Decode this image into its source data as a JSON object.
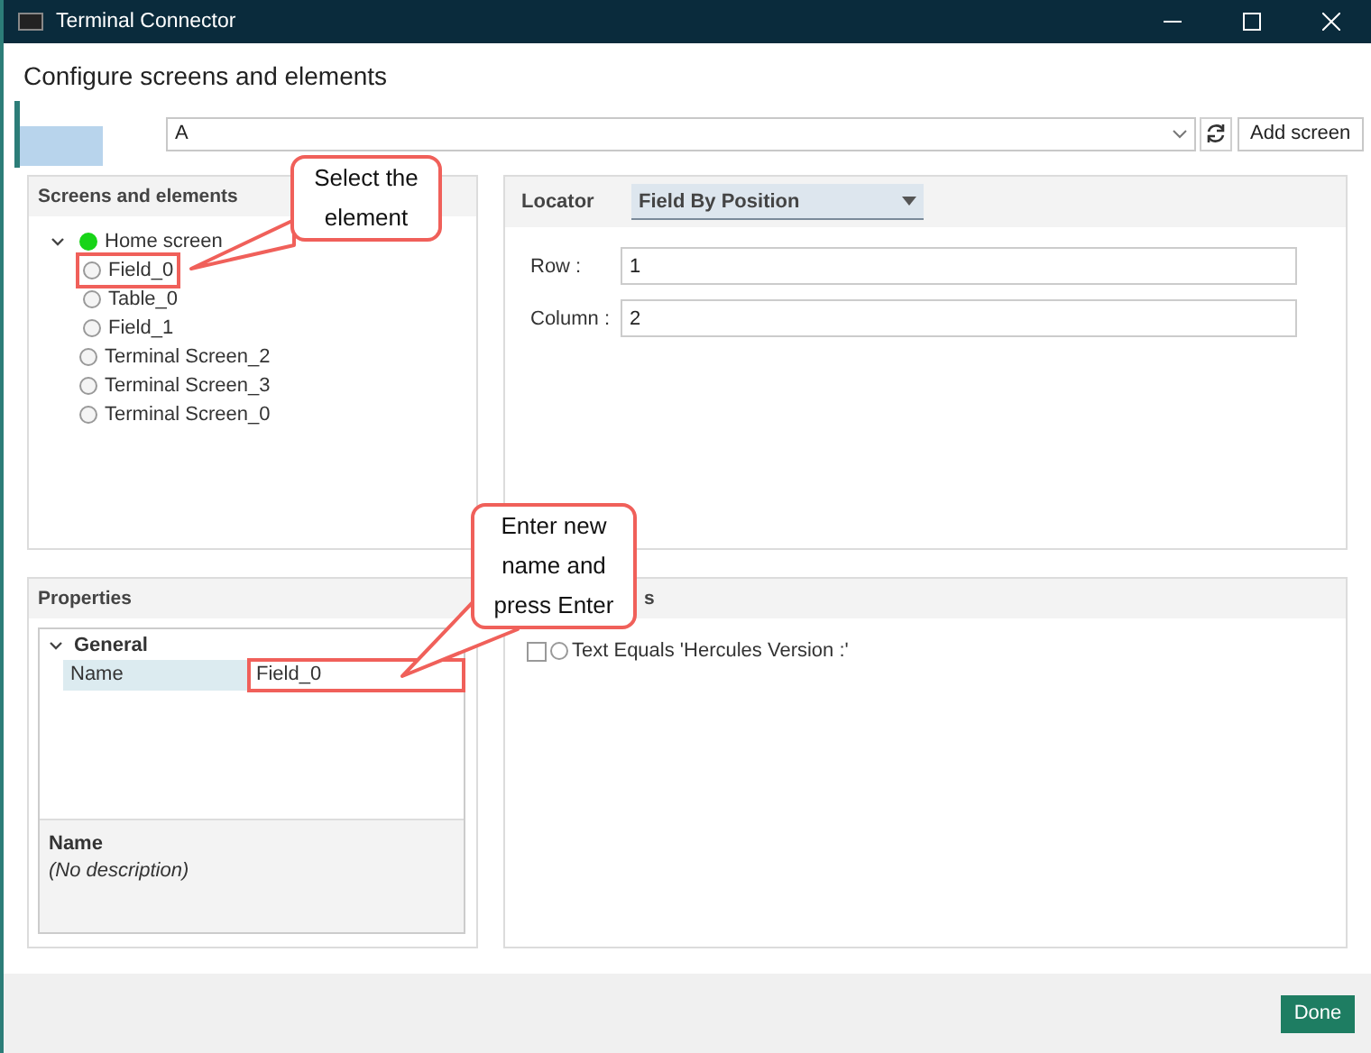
{
  "window": {
    "title": "Terminal Connector"
  },
  "heading": "Configure screens and elements",
  "screen_selector": {
    "value": "A"
  },
  "add_screen_button": "Add screen",
  "screens_panel": {
    "title": "Screens and elements",
    "tree": [
      {
        "label": "Home screen",
        "active": true,
        "expanded": true,
        "marked": false,
        "children": [
          {
            "label": "Field_0",
            "active": false,
            "marked": true
          },
          {
            "label": "Table_0",
            "active": false,
            "marked": false
          },
          {
            "label": "Field_1",
            "active": false,
            "marked": false
          }
        ]
      },
      {
        "label": "Terminal Screen_2",
        "active": false,
        "marked": false
      },
      {
        "label": "Terminal Screen_3",
        "active": false,
        "marked": false
      },
      {
        "label": "Terminal Screen_0",
        "active": false,
        "marked": false
      }
    ]
  },
  "locator_panel": {
    "label": "Locator",
    "value": "Field By Position",
    "fields": [
      {
        "label": "Row :",
        "value": "1"
      },
      {
        "label": "Column :",
        "value": "2"
      }
    ]
  },
  "properties_panel": {
    "title": "Properties",
    "group": {
      "label": "General",
      "expanded": true
    },
    "rows": [
      {
        "label": "Name",
        "value": "Field_0",
        "marked": true
      }
    ],
    "description": {
      "title": "Name",
      "text": "(No description)"
    }
  },
  "conditions_panel": {
    "title": "s",
    "items": [
      {
        "text": "Text Equals 'Hercules Version  :'",
        "checked": false
      }
    ]
  },
  "done_button": "Done",
  "callouts": [
    {
      "text": "Select the element"
    },
    {
      "text": "Enter new name and press Enter"
    }
  ]
}
